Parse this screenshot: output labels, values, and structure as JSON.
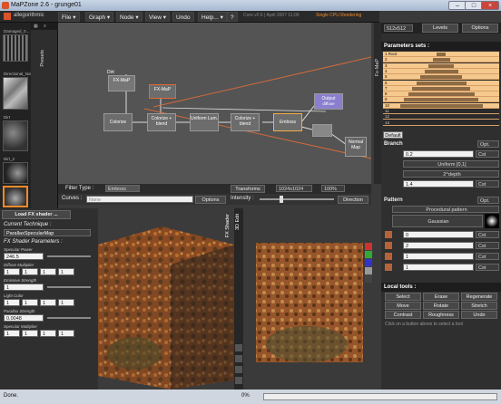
{
  "app": {
    "title": "MaPZone 2.6 - grunge01",
    "controls": [
      "–",
      "□",
      "×"
    ]
  },
  "menu": {
    "brand": "allegorithmic",
    "items": [
      "File ▾",
      "Graph ▾",
      "Node ▾",
      "View ▾",
      "Undo",
      "Help... ▾",
      "?"
    ],
    "core_info": "Core v2.6 | April 2007 11:09",
    "cpu_info": "Single CPU Rendering"
  },
  "left_panel": {
    "thumbs": [
      "Damaged_0...",
      "Directional_Noise",
      "Dirt",
      "Dirt_2",
      "Dirt_3"
    ],
    "presets_label": "Presets"
  },
  "graph": {
    "labels": {
      "dirt": "Dirt",
      "fxmap_a": "FX-MaP",
      "fxmap_b": "FX-MaP",
      "colorize": "Colorize",
      "colorize_blend": "Colorize + blend",
      "uniform": "Uniform Lum.",
      "colorize_blend2": "Colorize + blend",
      "emboss": "Emboss",
      "output": "Output",
      "output_sub": "diffuse",
      "normal": "Normal Map"
    },
    "fxmap_label": "Fx-MaP"
  },
  "right_panel": {
    "size": "512x512",
    "levels_tab": "Levels",
    "options_tab": "Options",
    "params_title": "Parameters sets :",
    "levels": [
      "1 Root",
      "2",
      "3",
      "4",
      "5",
      "6",
      "7",
      "8",
      "9",
      "10",
      "11",
      "12",
      "13"
    ],
    "default_tab": "Default",
    "branch": {
      "title": "Branch",
      "opt": "Opt.",
      "row1_value": "0.2",
      "row1_mode": "Cst",
      "row2_value": "Uniform [0,1[",
      "row3_value": "2^depth",
      "row4_value": "1.4",
      "row4_mode": "Cst"
    },
    "pattern": {
      "title": "Pattern",
      "opt": "Opt.",
      "type": "Procedural pattern",
      "shape": "Gaussian",
      "rows": [
        {
          "value": "0",
          "mode": "Cst"
        },
        {
          "value": "2",
          "mode": "Cst"
        },
        {
          "value": "1",
          "mode": "Cst"
        },
        {
          "value": "1",
          "mode": "Cst"
        }
      ]
    },
    "local_tools": {
      "title": "Local tools :",
      "buttons": [
        "Select",
        "Erase",
        "Regenerate",
        "Move",
        "Rotate",
        "Stretch",
        "Contrast",
        "Roughness",
        "Undo"
      ],
      "hint": "Click on a button above to select a tool"
    }
  },
  "filterbar": {
    "filter_type_label": "Filter Type :",
    "filter_value": "Emboss",
    "transforms": "Transforms",
    "resolution": "1024x1024",
    "zoom": "100%"
  },
  "curvesbar": {
    "curves_label": "Curves :",
    "curves_placeholder": "None",
    "options": "Options",
    "intensity_label": "Intensity :",
    "direction": "Direction"
  },
  "shader_panel": {
    "load_button": "Load FX shader ...",
    "current_label": "Current Technique :",
    "technique": "ParallaxSpecularMap",
    "params_label": "FX Shader Parameters :",
    "params": [
      {
        "name": "Specular Power",
        "values": [
          "246.5"
        ]
      },
      {
        "name": "Diffuse Multiplier",
        "values": [
          "1",
          "1",
          "1",
          "1"
        ]
      },
      {
        "name": "Emissive Strength",
        "values": [
          "1"
        ]
      },
      {
        "name": "Light Color",
        "values": [
          "1",
          "1",
          "1",
          "1"
        ]
      },
      {
        "name": "Parallax Strength",
        "values": [
          "0.0048"
        ]
      },
      {
        "name": "Specular Multiplier",
        "values": [
          "1",
          "1",
          "1",
          "1"
        ]
      }
    ]
  },
  "views": {
    "shader_label": "FX Shader",
    "edit_label": "3D Edit"
  },
  "status": {
    "text": "Done.",
    "progress": "0%"
  },
  "colors": {
    "accent": "#f08a2c",
    "panel": "#2f2f2f",
    "graph_bg": "#545454",
    "selection": "#f5c88d"
  }
}
